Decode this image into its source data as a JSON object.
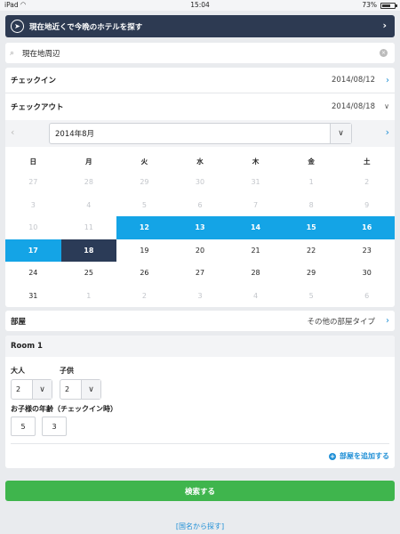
{
  "status_bar": {
    "carrier": "iPad",
    "wifi_icon": "wifi-icon",
    "time": "15:04",
    "battery_percent": "73%",
    "battery_level": 0.73
  },
  "nearby_banner": {
    "label": "現在地近くで今晩のホテルを探す",
    "icon": "navigation-arrow-icon",
    "chevron": "›"
  },
  "search": {
    "value": "現在地周辺",
    "icon": "search-icon",
    "clear_icon": "×"
  },
  "checkin": {
    "label": "チェックイン",
    "date": "2014/08/12"
  },
  "checkout": {
    "label": "チェックアウト",
    "date": "2014/08/18"
  },
  "calendar": {
    "month": "2014年8月",
    "prev": "‹",
    "next": "›",
    "weekdays": [
      "日",
      "月",
      "火",
      "水",
      "木",
      "金",
      "土"
    ],
    "rows": [
      [
        "",
        "",
        "",
        "",
        "",
        "1",
        "2"
      ],
      [
        "3",
        "4",
        "5",
        "6",
        "7",
        "8",
        "9"
      ],
      [
        "10",
        "11",
        "12",
        "13",
        "14",
        "15",
        "16"
      ],
      [
        "17",
        "18",
        "19",
        "20",
        "21",
        "22",
        "23"
      ],
      [
        "24",
        "25",
        "26",
        "27",
        "28",
        "29",
        "30"
      ],
      [
        "31",
        "",
        "",
        "",
        "",
        "",
        ""
      ]
    ],
    "selected_start": "12",
    "selected_end": "18",
    "colors": {
      "range": "#14a4e6",
      "end": "#2b3b57",
      "disabled": "#c3c6cb"
    }
  },
  "room_type": {
    "label": "部屋",
    "value": "その他の部屋タイプ"
  },
  "room": {
    "title": "Room 1",
    "adults_label": "大人",
    "adults_value": "2",
    "children_label": "子供",
    "children_value": "2",
    "child_age_label": "お子様の年齢（チェックイン時）",
    "child_ages": [
      "5",
      "3"
    ],
    "add_room": "部屋を追加する"
  },
  "search_button": {
    "label": "検索する",
    "color": "#3fb54d"
  },
  "country_link": {
    "label": "[国名から探す]"
  },
  "theme": {
    "navy": "#2d3a52",
    "accent": "#1f8fd6",
    "background": "#e9ebee"
  }
}
